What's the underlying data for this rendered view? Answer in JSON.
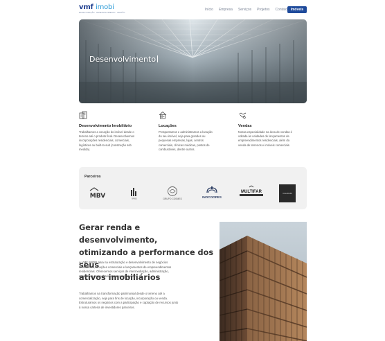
{
  "header": {
    "logo_main": "vmf",
    "logo_accent": "imobi",
    "logo_tagline": "ESTRUTURAÇÃO · DESENVOLVIMENTO · GESTÃO",
    "nav": [
      "Início",
      "Empresa",
      "Serviços",
      "Projetos",
      "Contato"
    ],
    "cta_label": "Imóveis",
    "accent_color": "#1e4a9b"
  },
  "hero": {
    "title": "Desenvolvimento"
  },
  "services": [
    {
      "icon": "building-document-icon",
      "title": "Desenvolvimento Imobiliário",
      "lines": [
        "Trabalhamos a vocação do imóvel desde o",
        "terreno até o produto final. Desenvolvemos",
        "incorporações residenciais, comerciais,",
        "logísticas ou built-to-suit (construção sob",
        "medida)."
      ]
    },
    {
      "icon": "house-key-icon",
      "title": "Locações",
      "lines": [
        "Prospectamos e administramos a locação",
        "do seu imóvel, seja para grandes ou",
        "pequenas empresas, lojas, centros",
        "comerciais, clínicas médicas, postos de",
        "combustíveis, dentre outros."
      ]
    },
    {
      "icon": "handshake-icon",
      "title": "Vendas",
      "lines": [
        "Nossa especialidade na área de vendas é",
        "voltada às unidades de lançamentos de",
        "empreendimentos residenciais, além da",
        "venda de terrenos e imóveis comerciais."
      ]
    }
  ],
  "partners": {
    "title": "Parceiros",
    "logos": [
      {
        "name": "MBV",
        "text": "MBV"
      },
      {
        "name": "bar-logo",
        "text": "BRISE"
      },
      {
        "name": "grupo-cosmes",
        "text": "GRUPO COSMES"
      },
      {
        "name": "inocoopes",
        "text": "INOCOOPES"
      },
      {
        "name": "multifar",
        "text": "MULTIFAR"
      },
      {
        "name": "dark-square",
        "text": "CALADIUM"
      }
    ]
  },
  "about": {
    "headline_lines": [
      "Gerar renda e desenvolvimento,",
      "otimizando a performance dos seus",
      "ativos imobiliários"
    ],
    "para1": [
      "A VMF IMOBI atua na estruturação e desenvolvimento de negócios",
      "imobiliários, locações comerciais e lançamentos de empreendimentos",
      "residenciais. Oferecemos serviços de intermediação, administração,",
      "arquitetura, engenharia e assessoria jurídica."
    ],
    "para2": [
      "Trabalhamos na transformação patrimonial desde o terreno até a",
      "comercialização, seja para fins de locação, incorporação ou venda.",
      "Estruturamos os negócios com a participação e captação de recursos junto",
      "à nossa carteira de investidores parceiros."
    ]
  }
}
